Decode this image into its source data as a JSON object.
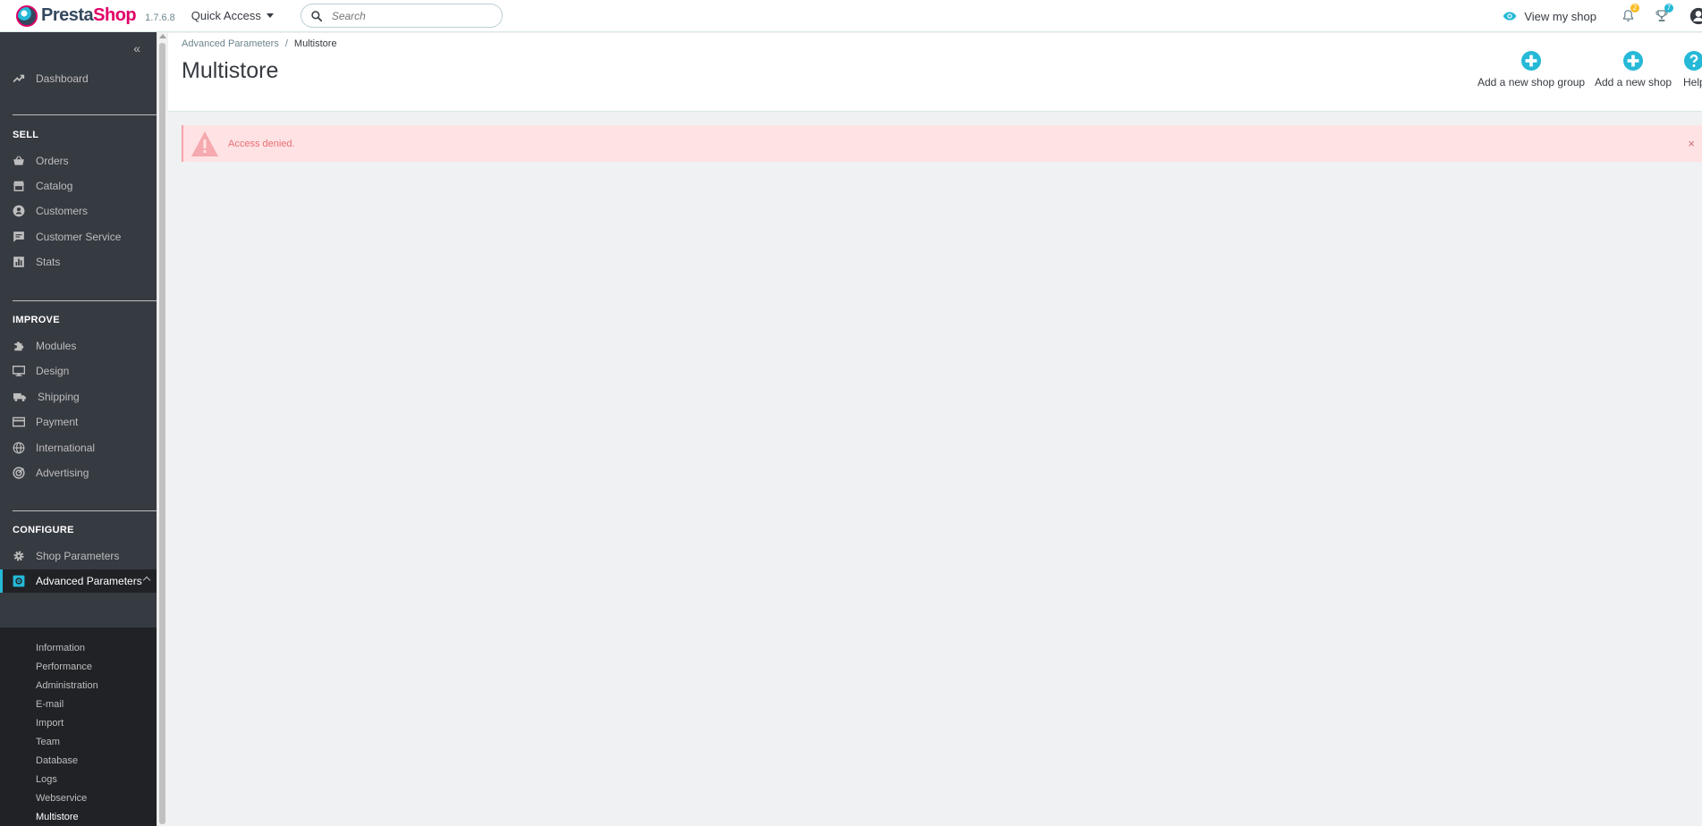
{
  "header": {
    "logo_prefix": "Presta",
    "logo_suffix": "Shop",
    "version": "1.7.6.8",
    "quick_access": "Quick Access",
    "search_placeholder": "Search",
    "view_my_shop": "View my shop",
    "notifications_count": "2",
    "orders_count": "7"
  },
  "sidebar": {
    "dashboard": "Dashboard",
    "sections": {
      "sell": "SELL",
      "improve": "IMPROVE",
      "configure": "CONFIGURE"
    },
    "sell_items": [
      "Orders",
      "Catalog",
      "Customers",
      "Customer Service",
      "Stats"
    ],
    "improve_items": [
      "Modules",
      "Design",
      "Shipping",
      "Payment",
      "International",
      "Advertising"
    ],
    "configure_items": [
      "Shop Parameters",
      "Advanced Parameters"
    ],
    "sub_items": [
      "Information",
      "Performance",
      "Administration",
      "E-mail",
      "Import",
      "Team",
      "Database",
      "Logs",
      "Webservice",
      "Multistore"
    ]
  },
  "page": {
    "breadcrumb_parent": "Advanced Parameters",
    "breadcrumb_sep": "/",
    "breadcrumb_current": "Multistore",
    "title": "Multistore",
    "toolbar": {
      "add_group": "Add a new shop group",
      "add_shop": "Add a new shop",
      "help": "Help"
    }
  },
  "alert": {
    "message": "Access denied.",
    "close": "×"
  },
  "colors": {
    "accent": "#25b9d7",
    "sidebar_bg": "#363a41",
    "alert_bg": "#ffe2e4",
    "alert_text": "#e87076"
  }
}
